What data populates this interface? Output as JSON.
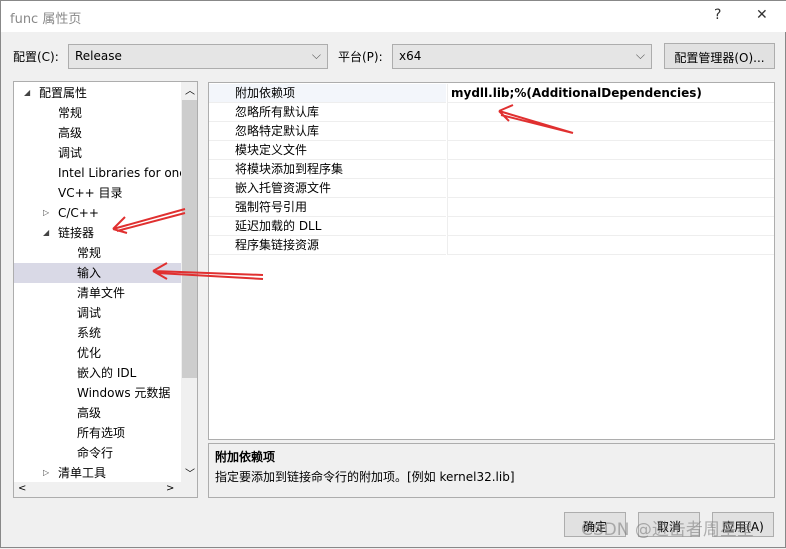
{
  "window": {
    "title": "func 属性页",
    "help": "?",
    "close": "✕"
  },
  "config": {
    "label": "配置(C):",
    "value": "Release",
    "platform_label": "平台(P):",
    "platform_value": "x64",
    "manager_button": "配置管理器(O)..."
  },
  "tree": [
    {
      "label": "配置属性",
      "expander": "◢",
      "level": 0
    },
    {
      "label": "常规",
      "level": 1
    },
    {
      "label": "高级",
      "level": 1
    },
    {
      "label": "调试",
      "level": 1
    },
    {
      "label": "Intel Libraries for oneAPI",
      "level": 1
    },
    {
      "label": "VC++ 目录",
      "level": 1
    },
    {
      "label": "C/C++",
      "expander": "▷",
      "level": 1
    },
    {
      "label": "链接器",
      "expander": "◢",
      "level": 1
    },
    {
      "label": "常规",
      "level": 2
    },
    {
      "label": "输入",
      "level": 2,
      "selected": true
    },
    {
      "label": "清单文件",
      "level": 2
    },
    {
      "label": "调试",
      "level": 2
    },
    {
      "label": "系统",
      "level": 2
    },
    {
      "label": "优化",
      "level": 2
    },
    {
      "label": "嵌入的 IDL",
      "level": 2
    },
    {
      "label": "Windows 元数据",
      "level": 2
    },
    {
      "label": "高级",
      "level": 2
    },
    {
      "label": "所有选项",
      "level": 2
    },
    {
      "label": "命令行",
      "level": 2
    },
    {
      "label": "清单工具",
      "expander": "▷",
      "level": 1
    }
  ],
  "properties": [
    {
      "name": "附加依赖项",
      "value": "mydll.lib;%(AdditionalDependencies)"
    },
    {
      "name": "忽略所有默认库",
      "value": ""
    },
    {
      "name": "忽略特定默认库",
      "value": ""
    },
    {
      "name": "模块定义文件",
      "value": ""
    },
    {
      "name": "将模块添加到程序集",
      "value": ""
    },
    {
      "name": "嵌入托管资源文件",
      "value": ""
    },
    {
      "name": "强制符号引用",
      "value": ""
    },
    {
      "name": "延迟加载的 DLL",
      "value": ""
    },
    {
      "name": "程序集链接资源",
      "value": ""
    }
  ],
  "description": {
    "title": "附加依赖项",
    "text": "指定要添加到链接命令行的附加项。[例如 kernel32.lib]"
  },
  "buttons": {
    "ok": "确定",
    "cancel": "取消",
    "apply": "应用(A)"
  },
  "watermark": "CSDN @进击者周星星",
  "annotation_color": "#e03030"
}
